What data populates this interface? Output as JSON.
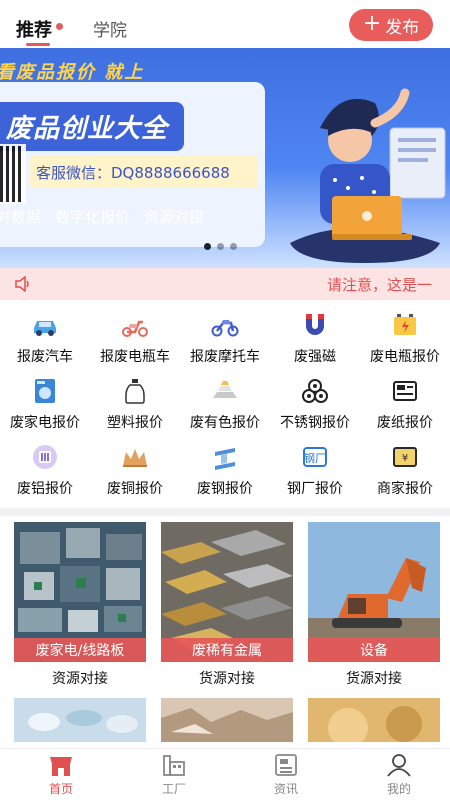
{
  "header": {
    "tabs": [
      {
        "label": "推荐",
        "active": true
      },
      {
        "label": "学院",
        "active": false
      }
    ],
    "publish_label": "发布",
    "accent_color": "#e85c5c"
  },
  "banner": {
    "slogan": "看废品报价 就上",
    "title": "废品创业大全",
    "wechat": "客服微信：DQ8888666688",
    "features": [
      "对数据",
      "数字化报价",
      "资源对接"
    ],
    "slide_count": 3,
    "active_slide": 0
  },
  "notice": {
    "icon": "speaker-icon",
    "text": "请注意，这是一"
  },
  "categories": [
    {
      "label": "报废汽车",
      "icon": "car-icon"
    },
    {
      "label": "报废电瓶车",
      "icon": "scooter-icon"
    },
    {
      "label": "报废摩托车",
      "icon": "motorcycle-icon"
    },
    {
      "label": "废强磁",
      "icon": "magnet-icon"
    },
    {
      "label": "废电瓶报价",
      "icon": "battery-icon"
    },
    {
      "label": "废家电报价",
      "icon": "washing-machine-icon"
    },
    {
      "label": "塑料报价",
      "icon": "plastic-bottle-icon"
    },
    {
      "label": "废有色报价",
      "icon": "metal-ingot-icon"
    },
    {
      "label": "不锈钢报价",
      "icon": "steel-pipes-icon"
    },
    {
      "label": "废纸报价",
      "icon": "newspaper-icon"
    },
    {
      "label": "废铝报价",
      "icon": "aluminum-icon"
    },
    {
      "label": "废铜报价",
      "icon": "copper-icon"
    },
    {
      "label": "废钢报价",
      "icon": "steel-beam-icon"
    },
    {
      "label": "钢厂报价",
      "icon": "steel-mill-icon"
    },
    {
      "label": "商家报价",
      "icon": "merchant-icon"
    }
  ],
  "cards": [
    {
      "tag": "废家电/线路板",
      "subtitle": "资源对接"
    },
    {
      "tag": "废稀有金属",
      "subtitle": "货源对接"
    },
    {
      "tag": "设备",
      "subtitle": "货源对接"
    }
  ],
  "bottom_nav": [
    {
      "label": "首页",
      "icon": "shop-icon",
      "active": true
    },
    {
      "label": "工厂",
      "icon": "factory-icon",
      "active": false
    },
    {
      "label": "资讯",
      "icon": "news-icon",
      "active": false
    },
    {
      "label": "我的",
      "icon": "user-icon",
      "active": false
    }
  ]
}
